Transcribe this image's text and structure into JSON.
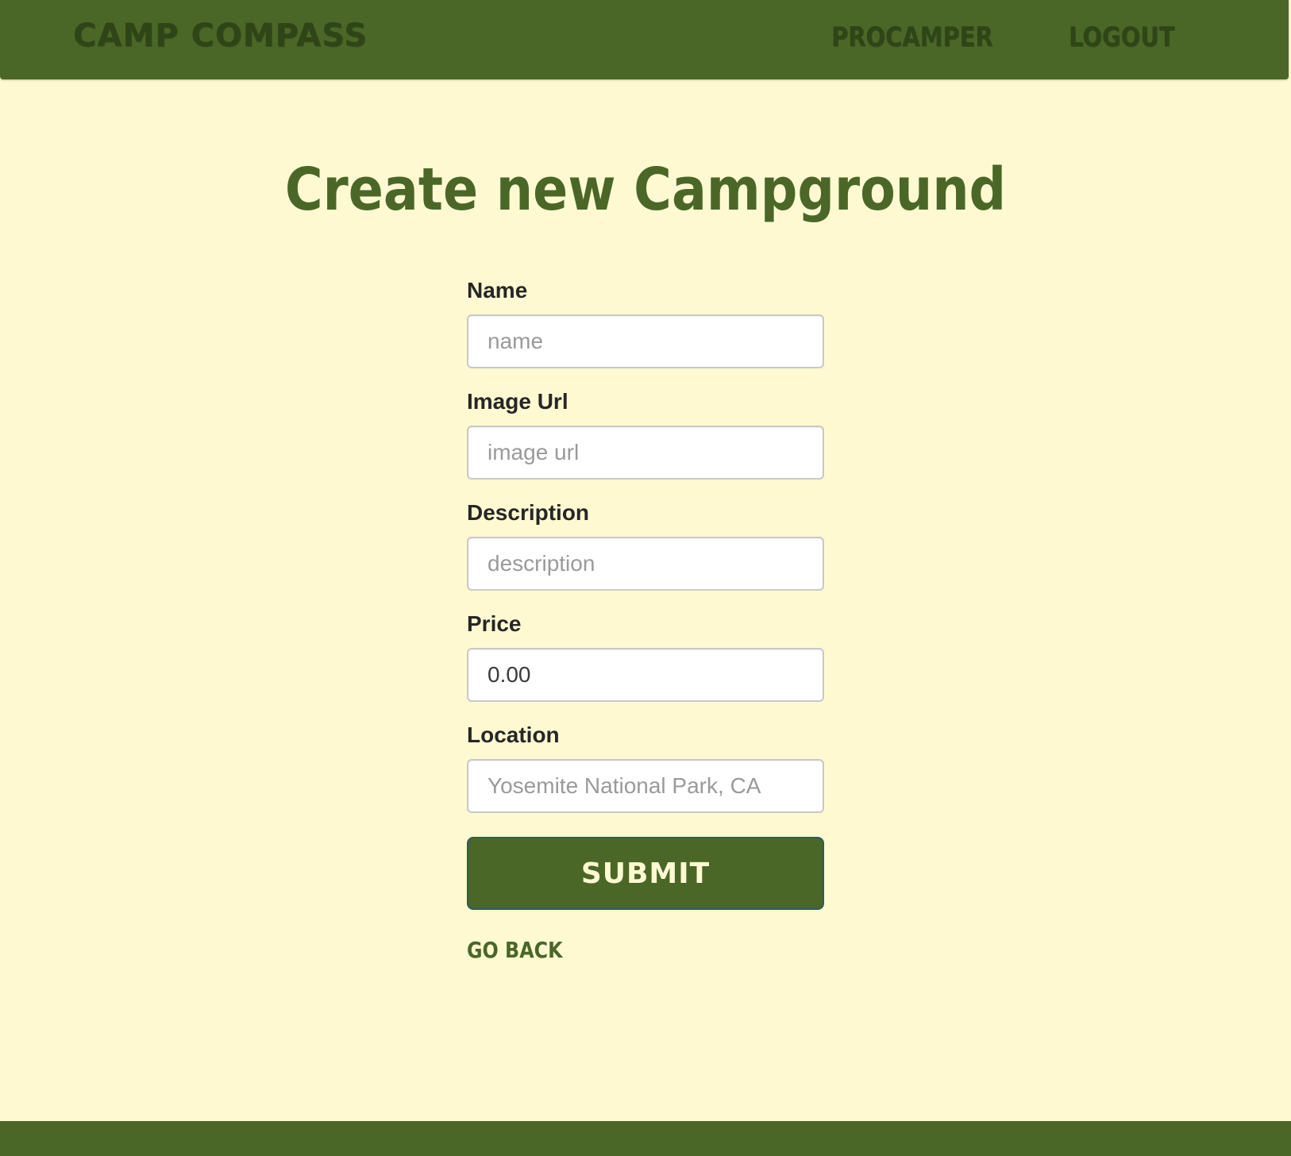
{
  "header": {
    "brand": "CAMP COMPASS",
    "nav": [
      "PROCAMPER",
      "LOGOUT"
    ]
  },
  "page": {
    "title": "Create new Campground"
  },
  "form": {
    "fields": [
      {
        "label": "Name",
        "placeholder": "name",
        "value": ""
      },
      {
        "label": "Image Url",
        "placeholder": "image url",
        "value": ""
      },
      {
        "label": "Description",
        "placeholder": "description",
        "value": ""
      },
      {
        "label": "Price",
        "placeholder": "",
        "value": "0.00"
      },
      {
        "label": "Location",
        "placeholder": "Yosemite National Park, CA",
        "value": ""
      }
    ],
    "submit_label": "SUBMIT",
    "back_label": "GO BACK"
  },
  "colors": {
    "primary_green": "#4a6727",
    "background": "#fff9d2",
    "nav_text": "#2f4517"
  }
}
